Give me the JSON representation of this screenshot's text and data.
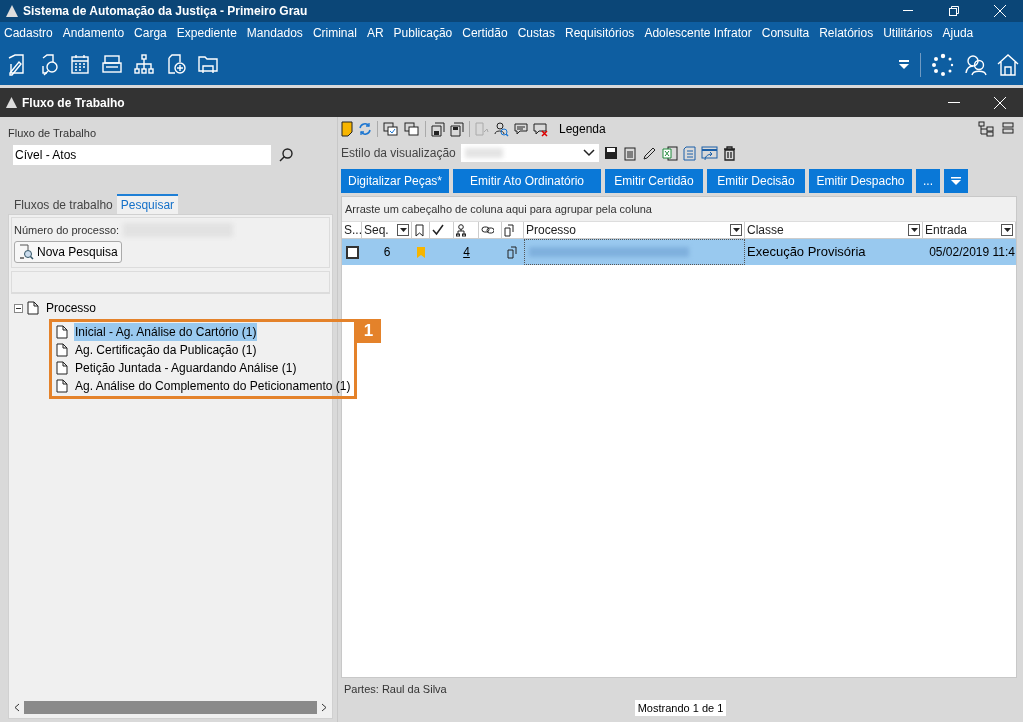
{
  "app_title": "Sistema de Automação da Justiça - Primeiro Grau",
  "menu": [
    "Cadastro",
    "Andamento",
    "Carga",
    "Expediente",
    "Mandados",
    "Criminal",
    "AR",
    "Publicação",
    "Certidão",
    "Custas",
    "Requisitórios",
    "Adolescente Infrator",
    "Consulta",
    "Relatórios",
    "Utilitários",
    "Ajuda"
  ],
  "panel_title": "Fluxo de Trabalho",
  "left": {
    "field_label": "Fluxo de Trabalho",
    "field_value": "Cível - Atos",
    "tabs": [
      {
        "label": "Fluxos de trabalho",
        "selected": false
      },
      {
        "label": "Pesquisar",
        "selected": true
      }
    ],
    "process_label": "Número do processo:",
    "search_button": "Nova Pesquisa",
    "tree": {
      "label": "Processo",
      "expanded": true,
      "children": [
        {
          "label": "Inicial - Ag. Análise do Cartório (1)",
          "selected": true
        },
        {
          "label": "Ag. Certificação da Publicação (1)",
          "selected": false
        },
        {
          "label": "Petição Juntada - Aguardando Análise (1)",
          "selected": false
        },
        {
          "label": "Ag. Análise do Complemento do Peticionamento (1)",
          "selected": false
        }
      ]
    }
  },
  "callout": {
    "label": "1"
  },
  "right": {
    "legend": "Legenda",
    "view_style_label": "Estilo da visualização",
    "actions": [
      "Digitalizar Peças*",
      "Emitir Ato Ordinatório",
      "Emitir Certidão",
      "Emitir Decisão",
      "Emitir Despacho",
      "..."
    ],
    "group_hint": "Arraste um cabeçalho de coluna aqui para agrupar pela coluna",
    "columns": [
      {
        "kind": "text",
        "label": "S..."
      },
      {
        "kind": "text",
        "label": "Seq.",
        "filter": true
      },
      {
        "kind": "icon"
      },
      {
        "kind": "icon"
      },
      {
        "kind": "icon"
      },
      {
        "kind": "icon"
      },
      {
        "kind": "icon"
      },
      {
        "kind": "text",
        "label": "Processo",
        "filter": true
      },
      {
        "kind": "text",
        "label": "Classe",
        "filter": true
      },
      {
        "kind": "text",
        "label": "Entrada",
        "filter": true
      }
    ],
    "rows": [
      {
        "selected": true,
        "checked": false,
        "seq": "6",
        "flagged": true,
        "count": "4",
        "classe": "Execução Provisória",
        "entrada": "05/02/2019 11:4"
      }
    ],
    "parties": "Partes: Raul da Silva",
    "paging": "Mostrando 1 de 1"
  }
}
